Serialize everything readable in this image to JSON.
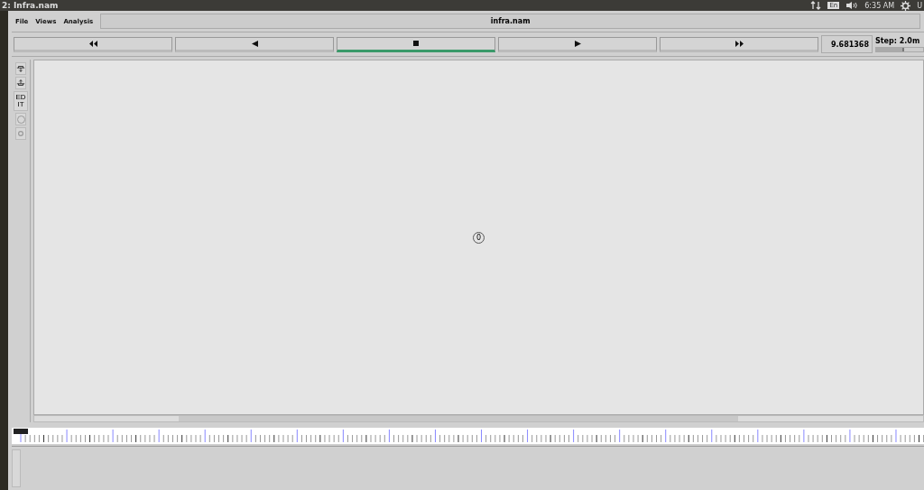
{
  "top_bar": {
    "title": "2: Infra.nam",
    "language": "En",
    "clock": "6:35 AM",
    "user": "U"
  },
  "menu": [
    "File",
    "Views",
    "Analysis"
  ],
  "file_name": "infra.nam",
  "transport": [
    {
      "kind": "fast-rewind",
      "selected": false
    },
    {
      "kind": "rewind",
      "selected": false
    },
    {
      "kind": "stop",
      "selected": true
    },
    {
      "kind": "play",
      "selected": false
    },
    {
      "kind": "fast-forward",
      "selected": false
    }
  ],
  "time": "9.681368",
  "step": {
    "label": "Step: 2.0m",
    "level": 0.6
  },
  "tools": [
    {
      "kind": "zoom-in"
    },
    {
      "kind": "zoom-out"
    },
    {
      "kind": "edit",
      "label": "EDIT"
    },
    {
      "kind": "circle"
    },
    {
      "kind": "dot"
    }
  ],
  "node": {
    "label": "0"
  }
}
